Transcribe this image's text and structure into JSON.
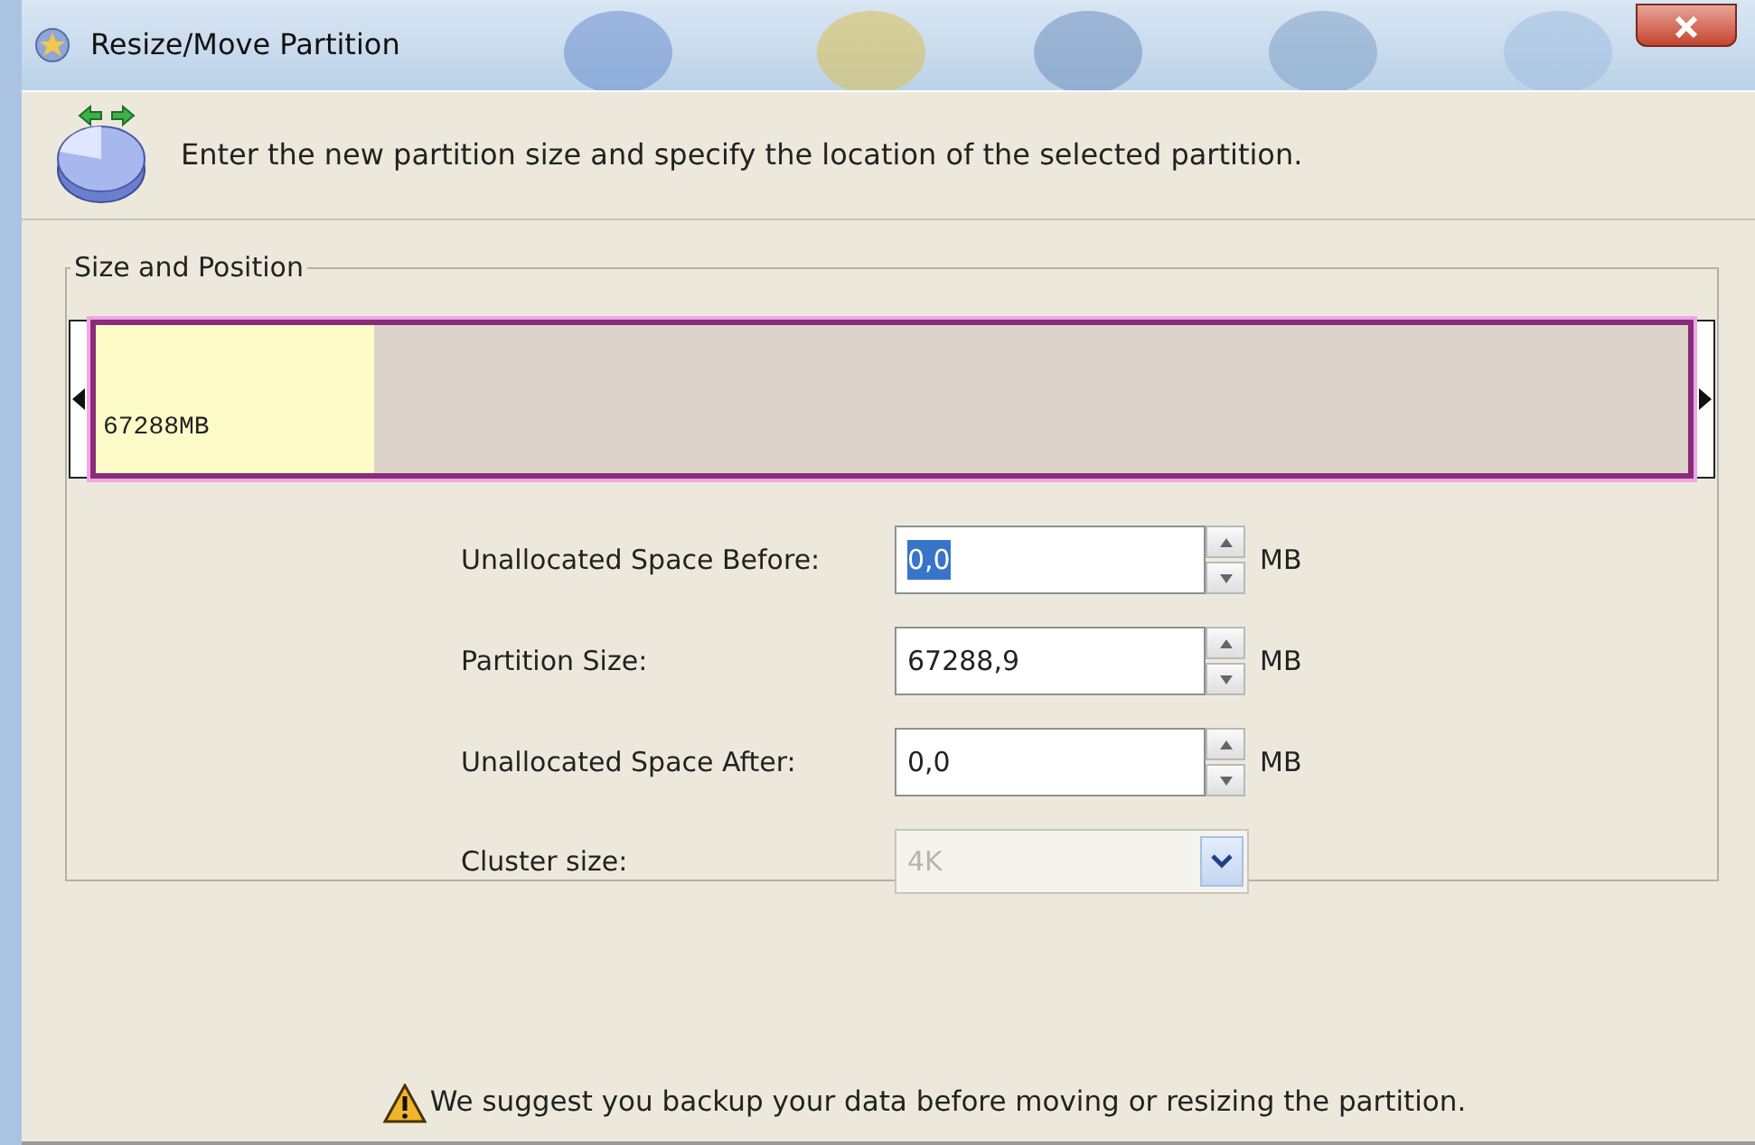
{
  "window": {
    "title": "Resize/Move Partition"
  },
  "header": {
    "text": "Enter the new partition size and specify the location of the selected partition."
  },
  "group": {
    "title": "Size and Position"
  },
  "partition_bar": {
    "label": "67288MB",
    "level": 0.175
  },
  "fields": [
    {
      "kind": "spin",
      "label": "Unallocated Space Before:",
      "value": "0,0",
      "unit": "MB",
      "selected": true
    },
    {
      "kind": "spin",
      "label": "Partition Size:",
      "value": "67288,9",
      "unit": "MB",
      "selected": false
    },
    {
      "kind": "spin",
      "label": "Unallocated Space After:",
      "value": "0,0",
      "unit": "MB",
      "selected": false
    },
    {
      "kind": "select",
      "label": "Cluster size:",
      "value": "4K",
      "disabled": true
    }
  ],
  "warning": {
    "text": "We suggest you backup your data before moving or resizing the partition."
  }
}
